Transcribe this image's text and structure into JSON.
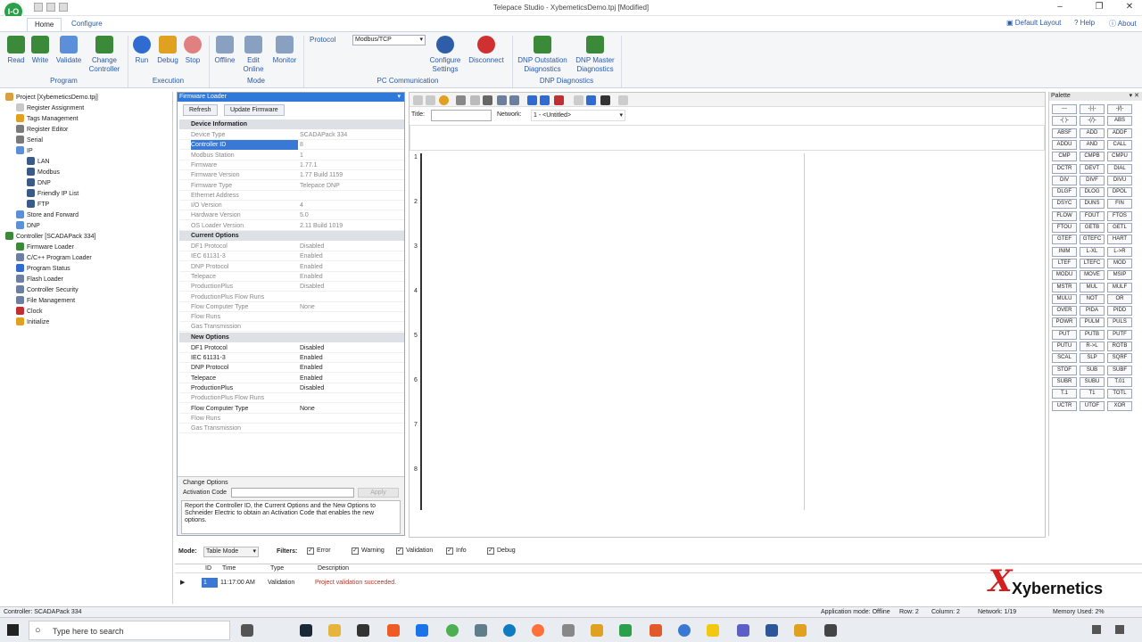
{
  "window": {
    "title": "Telepace Studio - XybemeticsDemo.tpj [Modified]"
  },
  "tabs": [
    "Home",
    "Configure"
  ],
  "ribbon_links": [
    "Default Layout",
    "Help",
    "About"
  ],
  "ribbon": {
    "buttons": [
      {
        "label": "Read",
        "color": "#3a8a3a"
      },
      {
        "label": "Write",
        "color": "#3a8a3a"
      },
      {
        "label": "Validate",
        "color": "#5b8fd9"
      },
      {
        "label": "Change Controller",
        "color": "#3a8a3a"
      },
      {
        "label": "Run",
        "color": "#2f6bd0"
      },
      {
        "label": "Debug",
        "color": "#e0a020"
      },
      {
        "label": "Stop",
        "color": "#d05050"
      },
      {
        "label": "Offline",
        "color": "#8aa0c0"
      },
      {
        "label": "Edit Online",
        "color": "#8aa0c0"
      },
      {
        "label": "Monitor",
        "color": "#8aa0c0"
      },
      {
        "label": "Configure Settings",
        "color": "#2f5ea8"
      },
      {
        "label": "Disconnect",
        "color": "#d03030"
      },
      {
        "label": "DNP Outstation Diagnostics",
        "color": "#3a8a3a"
      },
      {
        "label": "DNP Master Diagnostics",
        "color": "#3a8a3a"
      }
    ],
    "groups": [
      "Program",
      "Execution",
      "Mode",
      "PC Communication",
      "DNP Diagnostics"
    ],
    "protocol_label": "Protocol",
    "protocol_value": "Modbus/TCP"
  },
  "tree": [
    "Project [XybemeticsDemo.tpj]",
    "Register Assignment",
    "Tags Management",
    "Register Editor",
    "Serial",
    "IP",
    "LAN",
    "Modbus",
    "DNP",
    "Friendly IP List",
    "FTP",
    "Store and Forward",
    "DNP",
    "Controller [SCADAPack 334]",
    "Firmware Loader",
    "C/C++ Program Loader",
    "Program Status",
    "Flash Loader",
    "Controller Security",
    "File Management",
    "Clock",
    "Initialize"
  ],
  "firmware": {
    "header": "Firmware Loader",
    "refresh": "Refresh",
    "update": "Update Firmware",
    "sections": [
      {
        "title": "Device Information",
        "rows": [
          [
            "Device Type",
            "SCADAPack 334"
          ],
          [
            "Controller ID",
            "8"
          ],
          [
            "Modbus Station",
            "1"
          ],
          [
            "Firmware",
            "1.77.1"
          ],
          [
            "Firmware Version",
            "1.77 Build 1159"
          ],
          [
            "Firmware Type",
            "Telepace DNP"
          ],
          [
            "Ethernet Address",
            ""
          ],
          [
            "I/O Version",
            "4"
          ],
          [
            "Hardware Version",
            "5.0"
          ],
          [
            "OS Loader Version",
            "2.11 Build 1019"
          ]
        ]
      },
      {
        "title": "Current Options",
        "rows": [
          [
            "DF1 Protocol",
            "Disabled"
          ],
          [
            "IEC 61131-3",
            "Enabled"
          ],
          [
            "DNP Protocol",
            "Enabled"
          ],
          [
            "Telepace",
            "Enabled"
          ],
          [
            "ProductionPlus",
            "Disabled"
          ],
          [
            "ProductionPlus Flow Runs",
            ""
          ],
          [
            "Flow Computer Type",
            "None"
          ],
          [
            "Flow Runs",
            ""
          ],
          [
            "Gas Transmission",
            ""
          ]
        ]
      },
      {
        "title": "New Options",
        "rows": [
          [
            "DF1 Protocol",
            "Disabled"
          ],
          [
            "IEC 61131-3",
            "Enabled"
          ],
          [
            "DNP Protocol",
            "Enabled"
          ],
          [
            "Telepace",
            "Enabled"
          ],
          [
            "ProductionPlus",
            "Disabled"
          ],
          [
            "ProductionPlus Flow Runs",
            ""
          ],
          [
            "Flow Computer Type",
            "None"
          ],
          [
            "Flow Runs",
            ""
          ],
          [
            "Gas Transmission",
            ""
          ]
        ]
      }
    ],
    "change_options": "Change Options",
    "activation_code": "Activation Code",
    "apply": "Apply",
    "note": "Report the Controller ID, the Current Options and the New Options to Schneider Electric to obtain an Activation Code that enables the new options."
  },
  "ladder": {
    "title_label": "Title:",
    "network_label": "Network:",
    "network_value": "1 - <Untitled>",
    "rungs": [
      "1",
      "2",
      "3",
      "4",
      "5",
      "6",
      "7",
      "8"
    ]
  },
  "palette": {
    "title": "Palette",
    "items": [
      "---",
      "-|-|-",
      "-|/|-",
      "-( )-",
      "-(/)-",
      "ABS",
      "ABSF",
      "ADD",
      "ADDF",
      "ADDU",
      "AND",
      "CALL",
      "CMP",
      "CMPB",
      "CMPU",
      "DCTR",
      "DEVT",
      "DIAL",
      "DIV",
      "DIVF",
      "DIVU",
      "DLGF",
      "DLOG",
      "DPOL",
      "DSYC",
      "DUNS",
      "FIN",
      "FLOW",
      "FOUT",
      "FTOS",
      "FTOU",
      "GETB",
      "GETL",
      "GTEF",
      "GTEFC",
      "HART",
      "INIM",
      "L-XL",
      "L->R",
      "LTEF",
      "LTEFC",
      "MOD",
      "MODU",
      "MOVE",
      "MSIP",
      "MSTR",
      "MUL",
      "MULF",
      "MULU",
      "NOT",
      "OR",
      "OVER",
      "PIDA",
      "PIDD",
      "POWR",
      "PULM",
      "PULS",
      "PUT",
      "PUTB",
      "PUTF",
      "PUTU",
      "R->L",
      "ROTB",
      "SCAL",
      "SLP",
      "SQRF",
      "STOF",
      "SUB",
      "SUBF",
      "SUBR",
      "SUBU",
      "T.01",
      "T.1",
      "T1",
      "TOTL",
      "UCTR",
      "UTOF",
      "XOR"
    ]
  },
  "messages": {
    "mode_label": "Mode:",
    "mode_value": "Table Mode",
    "filters_label": "Filters:",
    "filters": [
      "Error",
      "Warning",
      "Validation",
      "Info",
      "Debug"
    ],
    "columns": [
      "ID",
      "Time",
      "Type",
      "Description"
    ],
    "rows": [
      {
        "id": "1",
        "time": "11:17:00 AM",
        "type": "Validation",
        "desc": "Project validation succeeded."
      }
    ],
    "brand": "Xybernetics"
  },
  "status": {
    "controller": "Controller: SCADAPack 334",
    "app_mode": "Application mode: Offline",
    "row": "Row: 2",
    "column": "Column: 2",
    "network": "Network: 1/19",
    "memory": "Memory Used: 2%"
  },
  "taskbar": {
    "search_placeholder": "Type here to search"
  }
}
